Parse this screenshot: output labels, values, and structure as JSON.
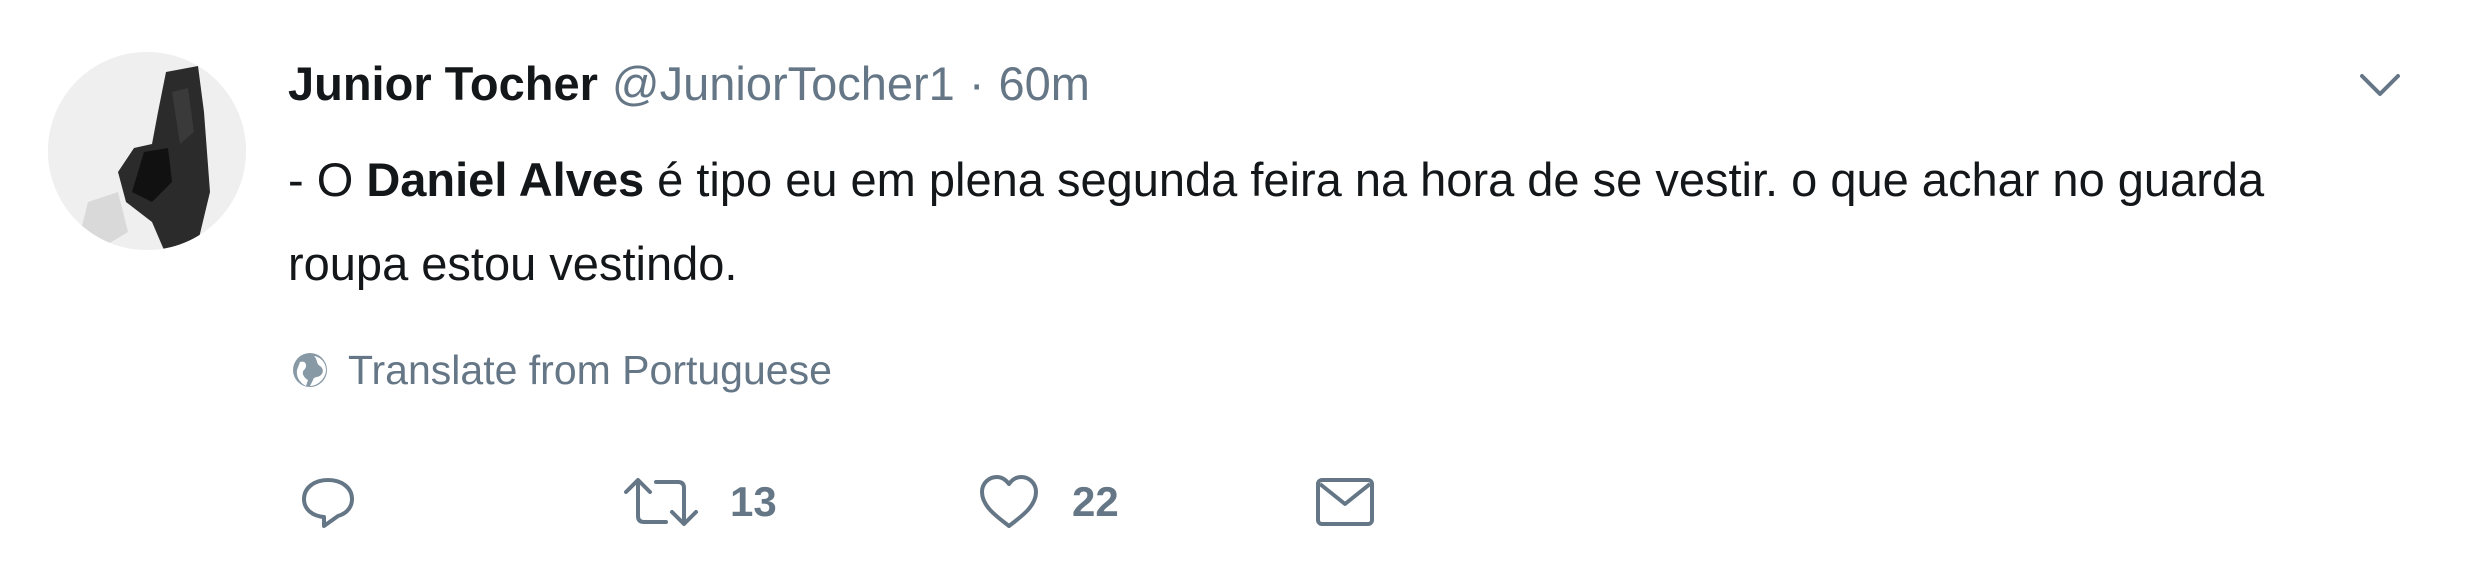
{
  "tweet": {
    "author_name": "Junior Tocher",
    "author_handle": "@JuniorTocher1",
    "separator": "·",
    "timestamp": "60m",
    "text_prefix": "- O ",
    "text_mention": "Daniel Alves",
    "text_suffix": " é tipo eu em plena segunda feira na hora de se vestir. o que achar no guarda roupa estou vestindo.",
    "translate_label": "Translate from Portuguese",
    "retweet_count": "13",
    "like_count": "22"
  },
  "icons": {
    "caret": "chevron-down-icon",
    "translate": "globe-icon",
    "reply": "reply-icon",
    "retweet": "retweet-icon",
    "like": "heart-icon",
    "message": "envelope-icon"
  },
  "colors": {
    "text": "#14171a",
    "muted": "#657786",
    "background": "#ffffff"
  }
}
